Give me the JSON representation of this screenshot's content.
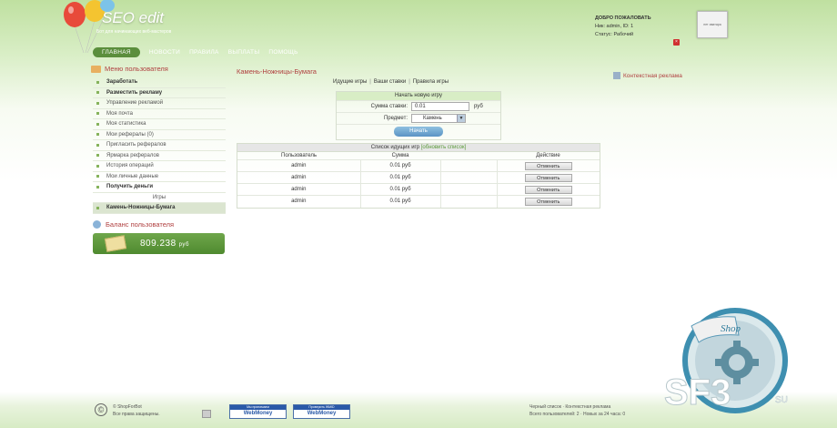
{
  "header": {
    "logo": "SEO edit",
    "tagline": "Бот для начинающих веб-мастеров",
    "welcome_title": "ДОБРО ПОЖАЛОВАТЬ",
    "user_line": "Ник: admin, ID: 1",
    "status_line": "Статус: Рабочий",
    "avatar_text": "нет аватара"
  },
  "topnav": [
    "ГЛАВНАЯ",
    "НОВОСТИ",
    "ПРАВИЛА",
    "ВЫПЛАТЫ",
    "ПОМОЩЬ"
  ],
  "sidebar": {
    "menu_title": "Меню пользователя",
    "items": [
      {
        "label": "Заработать",
        "bold": true
      },
      {
        "label": "Разместить рекламу",
        "bold": true
      },
      {
        "label": "Управление рекламой"
      },
      {
        "label": "Моя почта"
      },
      {
        "label": "Моя статистика"
      },
      {
        "label": "Мои рефералы (0)"
      },
      {
        "label": "Пригласить рефералов"
      },
      {
        "label": "Ярмарка рефералов"
      },
      {
        "label": "История операций"
      },
      {
        "label": "Мои личные данные"
      },
      {
        "label": "Получить деньги",
        "bold": true
      },
      {
        "label": "Игры",
        "sub": true
      },
      {
        "label": "Камень-Ножницы-Бумага",
        "active": true
      }
    ],
    "balance_title": "Баланс пользователя",
    "balance_value": "809.238",
    "balance_currency": "руб"
  },
  "main": {
    "title": "Камень-Ножницы-Бумага",
    "subnav": [
      "Идущие игры",
      "Ваши ставки",
      "Правила игры"
    ],
    "form": {
      "header": "Начать новую игру",
      "stake_label": "Сумма ставки:",
      "stake_value": "0.01",
      "stake_unit": "руб",
      "item_label": "Предмет:",
      "item_value": "Камень",
      "submit": "Начать"
    },
    "games": {
      "caption": "Список идущих игр",
      "refresh": "[обновить список]",
      "columns": [
        "Пользователь",
        "Сумма",
        "",
        "Действие"
      ],
      "rows": [
        {
          "user": "admin",
          "sum": "0.01 руб",
          "action": "Отменить"
        },
        {
          "user": "admin",
          "sum": "0.01 руб",
          "action": "Отменить"
        },
        {
          "user": "admin",
          "sum": "0.01 руб",
          "action": "Отменить"
        },
        {
          "user": "admin",
          "sum": "0.01 руб",
          "action": "Отменить"
        }
      ]
    }
  },
  "ads": {
    "title": "Контекстная реклама"
  },
  "footer": {
    "copyright": "© ShopForBot",
    "rights": "Все права защищены.",
    "wm1_top": "Мы принимаем",
    "wm1_name": "WebMoney",
    "wm2_top": "Проверить WMID",
    "wm2_name": "WebMoney",
    "stats_line1": "Черный список · Контекстная реклама",
    "stats_line2": "Всего пользователей: 2 · Новых за 24 часа: 0"
  },
  "watermark": {
    "shop": "Shop",
    "site": "SF3",
    "tld": "SU"
  },
  "colors": {
    "accent_green": "#5b8e3c",
    "title_red": "#b04040",
    "button_blue": "#5b93c4"
  }
}
